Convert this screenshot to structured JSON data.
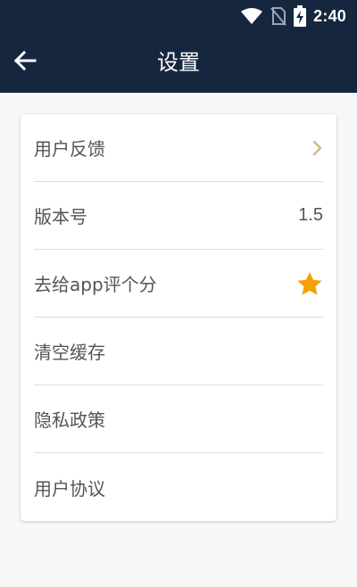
{
  "status_bar": {
    "time": "2:40",
    "icons": [
      "wifi-icon",
      "no-sim-icon",
      "battery-charging-icon"
    ]
  },
  "app_bar": {
    "title": "设置",
    "back_icon": "arrow-left-icon"
  },
  "colors": {
    "header_bg": "#16263f",
    "chevron": "#d2b98a",
    "star": "#f5a000",
    "text": "#555555",
    "divider": "#dcdcdc",
    "page_bg": "#f7f7f7"
  },
  "settings": {
    "items": [
      {
        "label": "用户反馈",
        "trailing": "chevron-right-icon"
      },
      {
        "label": "版本号",
        "value": "1.5"
      },
      {
        "label": "去给app评个分",
        "trailing": "star-icon"
      },
      {
        "label": "清空缓存"
      },
      {
        "label": "隐私政策"
      },
      {
        "label": "用户协议"
      }
    ]
  }
}
